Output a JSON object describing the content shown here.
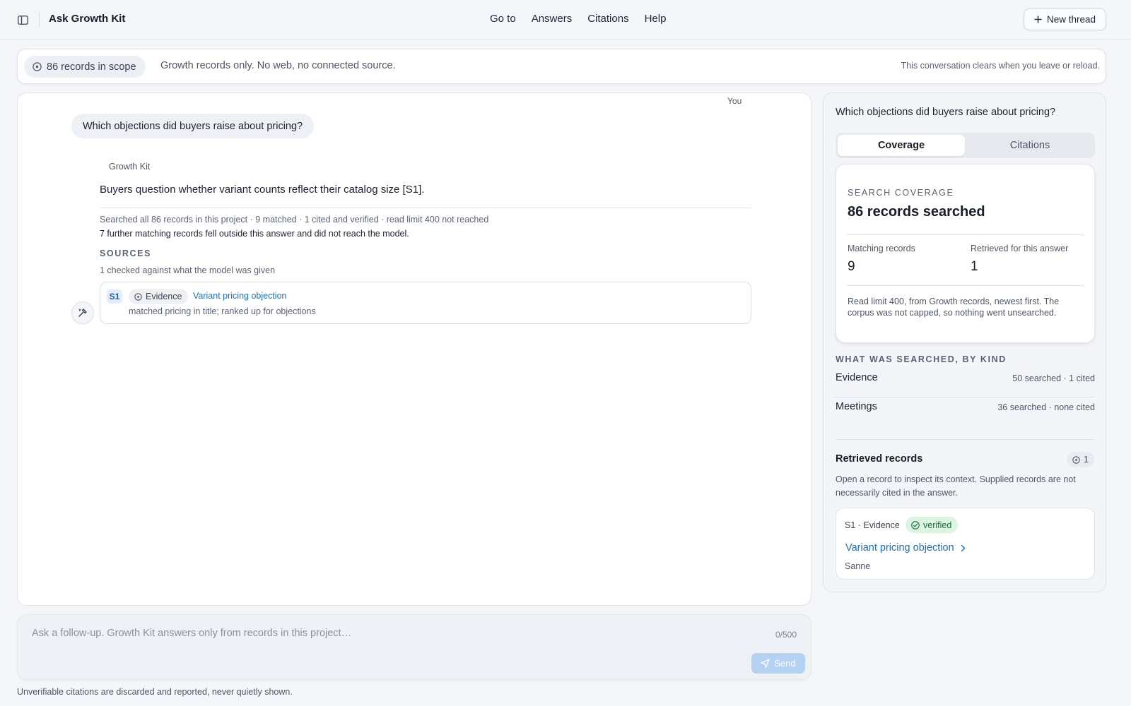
{
  "app": {
    "title": "Ask Growth Kit"
  },
  "nav": {
    "items": [
      "Go to",
      "Answers",
      "Citations",
      "Help"
    ]
  },
  "header": {
    "new_thread_label": "New thread"
  },
  "scope": {
    "chip_label": "86 records in scope",
    "description": "Growth records only. No web, no connected source.",
    "note": "This conversation clears when you leave or reload."
  },
  "thread": {
    "you_label": "You",
    "question": "Which objections did buyers raise about pricing?",
    "assistant_name": "Growth Kit",
    "answer": "Buyers question whether variant counts reflect their catalog size [S1].",
    "search_summary": "Searched all 86 records in this project · 9 matched · 1 cited and verified · read limit 400 not reached",
    "search_note": "7 further matching records fell outside this answer and did not reach the model.",
    "sources_heading": "SOURCES",
    "sources_sub": "1 checked against what the model was given",
    "sources": [
      {
        "tag": "S1",
        "kind": "Evidence",
        "title": "Variant pricing objection",
        "detail": "matched pricing in title; ranked up for objections"
      }
    ]
  },
  "composer": {
    "placeholder": "Ask a follow-up. Growth Kit answers only from records in this project…",
    "value": "",
    "char_count": "0/500",
    "send_label": "Send"
  },
  "footer": {
    "note": "Unverifiable citations are discarded and reported, never quietly shown."
  },
  "side": {
    "question": "Which objections did buyers raise about pricing?",
    "tabs": [
      "Coverage",
      "Citations"
    ],
    "active_tab": "Coverage",
    "coverage": {
      "kicker": "SEARCH COVERAGE",
      "title": "86 records searched",
      "stats": [
        {
          "label": "Matching records",
          "value": "9"
        },
        {
          "label": "Retrieved for this answer",
          "value": "1"
        }
      ],
      "description": "Read limit 400, from Growth records, newest first. The corpus was not capped, so nothing went unsearched."
    },
    "kinds_heading": "WHAT WAS SEARCHED, BY KIND",
    "kinds": [
      {
        "name": "Evidence",
        "count": "50 searched · 1 cited"
      },
      {
        "name": "Meetings",
        "count": "36 searched · none cited"
      }
    ],
    "retrieved": {
      "title": "Retrieved records",
      "count": "1",
      "description": "Open a record to inspect its context. Supplied records are not necessarily cited in the answer.",
      "records": [
        {
          "meta": "S1 · Evidence",
          "status": "verified",
          "title": "Variant pricing objection",
          "owner": "Sanne"
        }
      ]
    }
  },
  "colors": {
    "accent": "#1d6fc0",
    "verified_bg": "#dcf5e3",
    "verified_text": "#17713b",
    "send_disabled": "#b5d2f4"
  },
  "icons": {
    "sidebar_toggle": "sidebar-panel-icon",
    "new_thread": "plus-icon",
    "scope": "target-icon",
    "tools": "tools-icon",
    "send": "paper-plane-icon",
    "verified": "check-circle-icon",
    "record_open": "chevron-right-icon"
  }
}
